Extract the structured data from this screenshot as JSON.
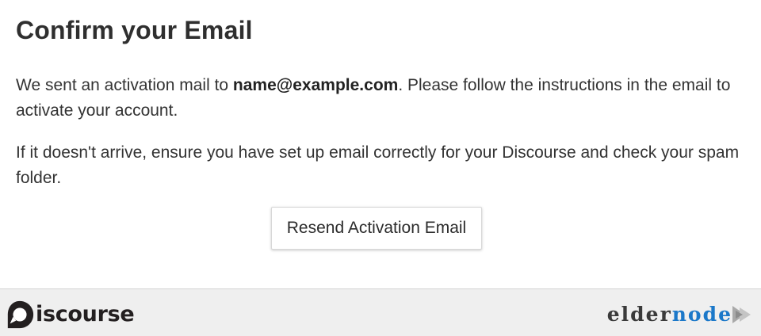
{
  "confirm": {
    "title": "Confirm your Email",
    "para1_before": "We sent an activation mail to ",
    "email": "name@example.com",
    "para1_after": ". Please follow the instructions in the email to activate your account.",
    "para2": "If it doesn't arrive, ensure you have set up email correctly for your Discourse and check your spam folder.",
    "resend_label": "Resend Activation Email"
  },
  "footer": {
    "left_logo_text": "iscourse",
    "left_logo_icon": "discourse-logo-icon",
    "right_logo_text_part1": "elder",
    "right_logo_text_part2": "node",
    "right_logo_icon": "play-arrows-icon"
  },
  "colors": {
    "accent": "#1b78c9",
    "footer_bg": "#efefef",
    "text": "#333333"
  }
}
